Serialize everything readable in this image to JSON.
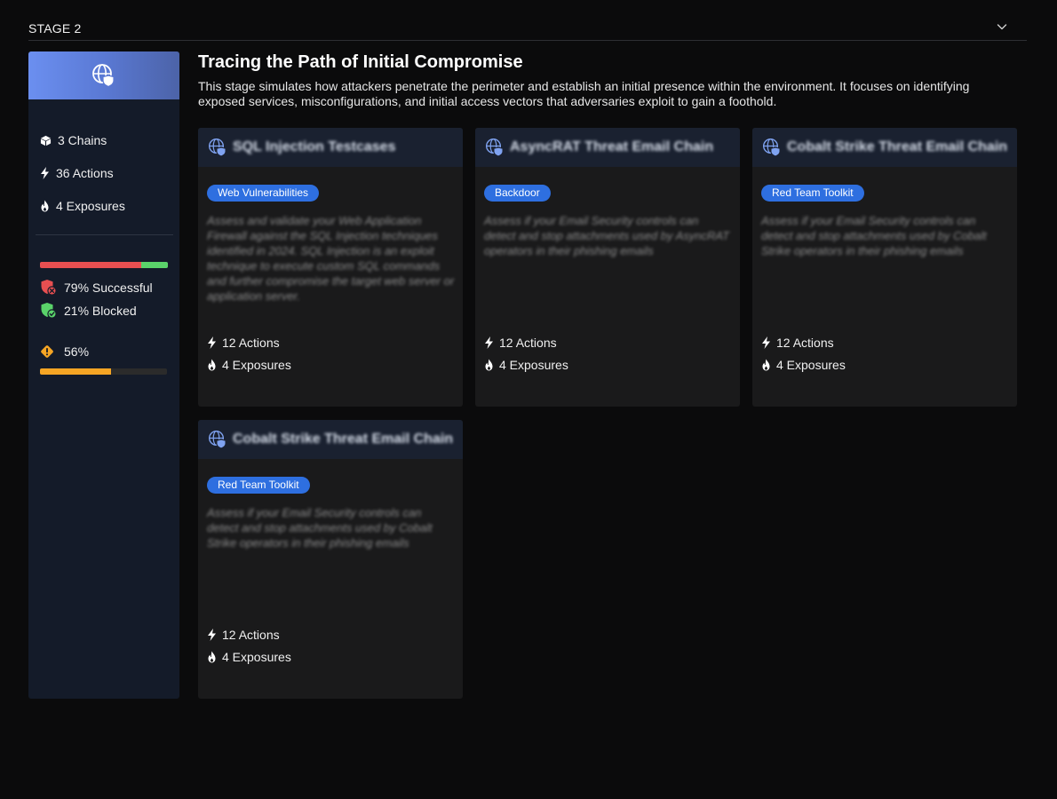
{
  "stage": {
    "label": "STAGE 2"
  },
  "sidebar": {
    "chains": "3 Chains",
    "actions": "36 Actions",
    "exposures": "4 Exposures",
    "successful_pct": 79,
    "blocked_pct": 21,
    "successful_label": "79% Successful",
    "blocked_label": "21% Blocked",
    "score_pct": 56,
    "score_label": "56%"
  },
  "main": {
    "title": "Tracing the Path of Initial Compromise",
    "description": "This stage simulates how attackers penetrate the perimeter and establish an initial presence within the environment. It focuses on identifying exposed services, misconfigurations, and initial access vectors that adversaries exploit to gain a foothold."
  },
  "cards": [
    {
      "title": "SQL Injection Testcases",
      "tag": "Web Vulnerabilities",
      "description": "Assess and validate your Web Application Firewall against the SQL Injection techniques identified in 2024. SQL Injection is an exploit technique to execute custom SQL commands and further compromise the target web server or application server.",
      "actions": "12 Actions",
      "exposures": "4 Exposures"
    },
    {
      "title": "AsyncRAT Threat Email Chain",
      "tag": "Backdoor",
      "description": "Assess if your Email Security controls can detect and stop attachments used by AsyncRAT operators in their phishing emails",
      "actions": "12 Actions",
      "exposures": "4 Exposures"
    },
    {
      "title": "Cobalt Strike Threat Email Chain",
      "tag": "Red Team Toolkit",
      "description": "Assess if your Email Security controls can detect and stop attachments used by Cobalt Strike operators in their phishing emails",
      "actions": "12 Actions",
      "exposures": "4 Exposures"
    },
    {
      "title": "Cobalt Strike Threat Email Chain",
      "tag": "Red Team Toolkit",
      "description": "Assess if your Email Security controls can detect and stop attachments used by Cobalt Strike operators in their phishing emails",
      "actions": "12 Actions",
      "exposures": "4 Exposures"
    }
  ],
  "colors": {
    "accent": "#2e6fe0",
    "successful": "#e84f51",
    "blocked": "#5ad36a",
    "score": "#f5a524",
    "sidebar_bg": "#141b29",
    "card_bg": "#1a1a1b"
  },
  "icons": {
    "banner": "globe-shield-icon",
    "chains": "cube-icon",
    "actions": "lightning-icon",
    "exposures": "flame-icon",
    "successful": "shield-x-icon",
    "blocked": "shield-check-icon",
    "score": "warning-icon",
    "collapse": "chevron-down-icon"
  }
}
